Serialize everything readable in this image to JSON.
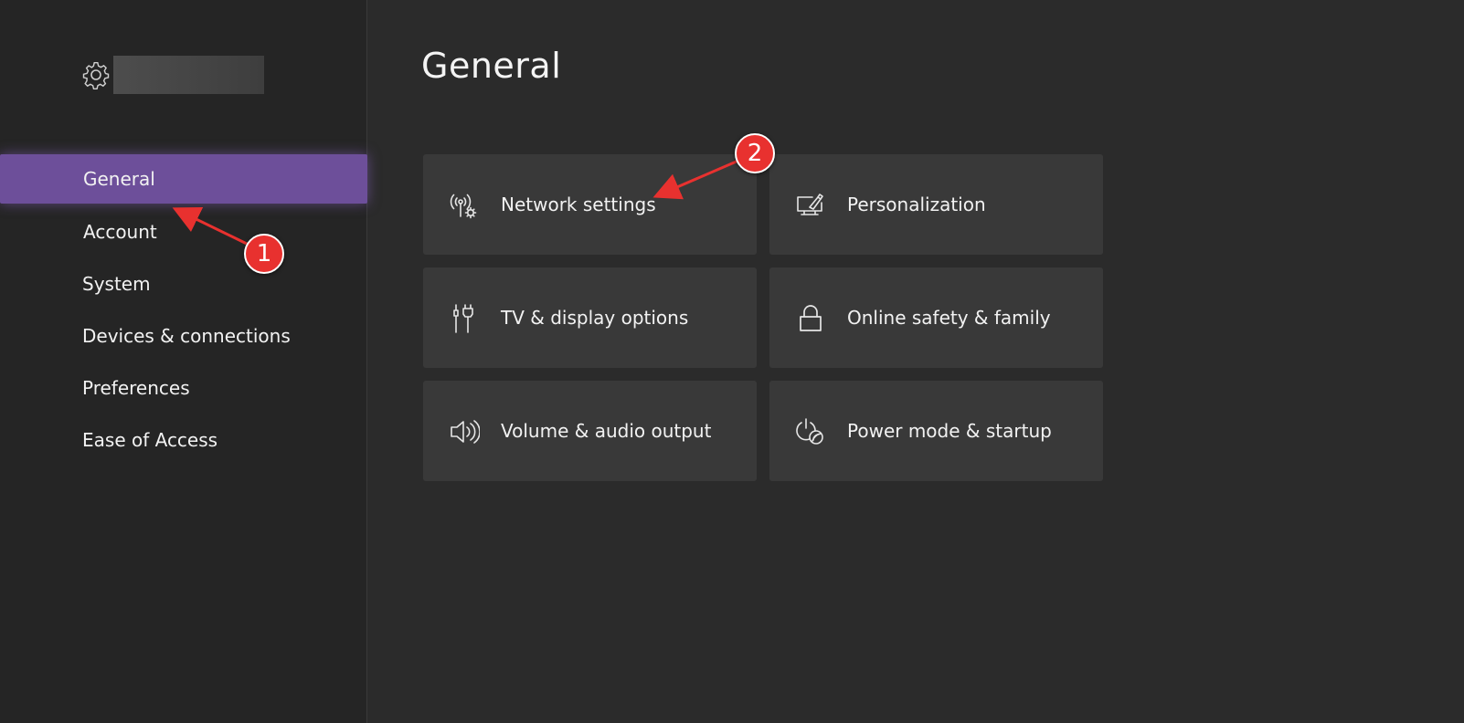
{
  "header": {
    "title": "General"
  },
  "sidebar": {
    "items": [
      {
        "label": "General",
        "selected": true
      },
      {
        "label": "Account"
      },
      {
        "label": "System"
      },
      {
        "label": "Devices & connections"
      },
      {
        "label": "Preferences"
      },
      {
        "label": "Ease of Access"
      }
    ]
  },
  "tiles": [
    {
      "label": "Network settings",
      "icon": "network-gear-icon"
    },
    {
      "label": "Personalization",
      "icon": "monitor-brush-icon"
    },
    {
      "label": "TV & display options",
      "icon": "cable-plug-icon"
    },
    {
      "label": "Online safety & family",
      "icon": "lock-icon"
    },
    {
      "label": "Volume & audio output",
      "icon": "speaker-icon"
    },
    {
      "label": "Power mode & startup",
      "icon": "power-leaf-icon"
    }
  ],
  "annotations": [
    {
      "number": "1"
    },
    {
      "number": "2"
    }
  ],
  "colors": {
    "accent": "#6d4f9a",
    "background": "#2b2b2b",
    "sidebar": "#252525",
    "tile": "#393939",
    "marker": "#e8312f"
  }
}
